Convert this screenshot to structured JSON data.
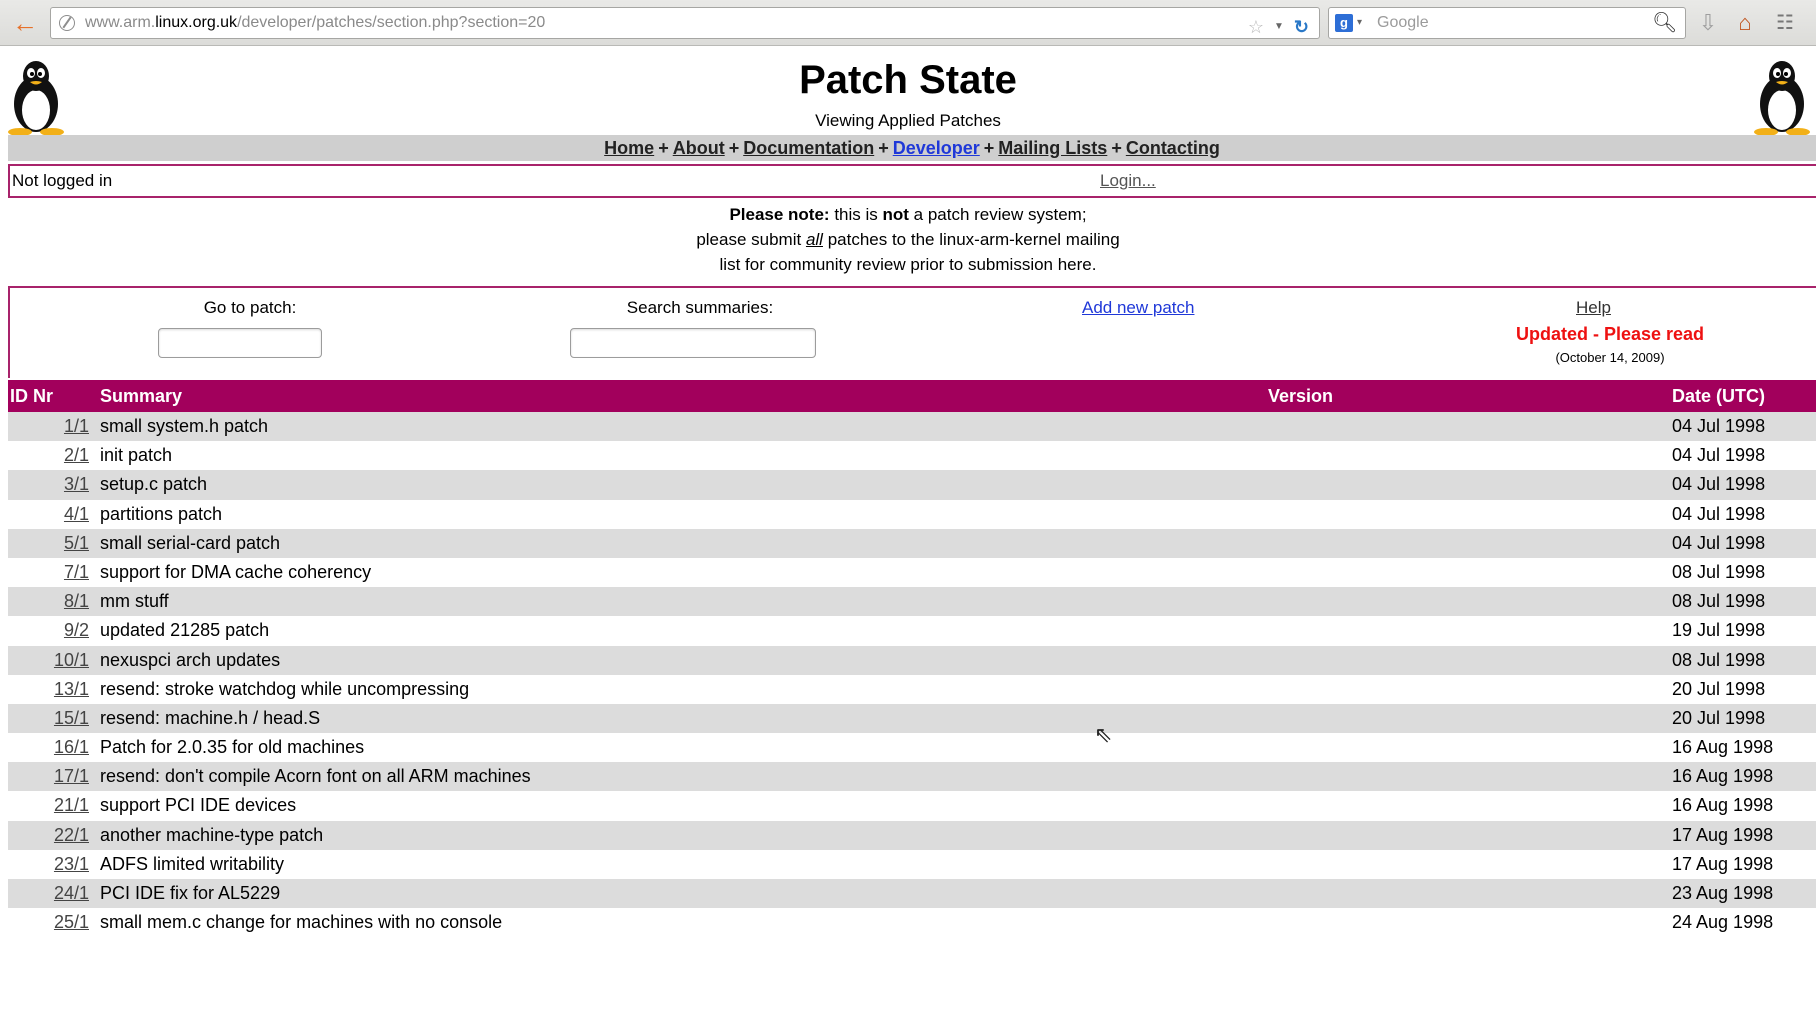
{
  "browser": {
    "url_prefix": "www.arm.",
    "url_host": "linux.org.uk",
    "url_path": "/developer/patches/section.php?section=20",
    "search_placeholder": "Google"
  },
  "page": {
    "title": "Patch State",
    "subtitle": "Viewing Applied Patches"
  },
  "nav": {
    "items": [
      "Home",
      "About",
      "Documentation",
      "Developer",
      "Mailing Lists",
      "Contacting"
    ],
    "separator": "+"
  },
  "login": {
    "status": "Not logged in",
    "link": "Login..."
  },
  "note": {
    "bold_intro": "Please note:",
    "line1_a": " this is ",
    "line1_bold": "not",
    "line1_b": " a patch review system;",
    "line2_a": "please submit ",
    "line2_em": "all",
    "line2_b": " patches to the linux-arm-kernel mailing",
    "line3": "list for community review prior to submission here."
  },
  "controls": {
    "goto_label": "Go to patch:",
    "search_label": "Search summaries:",
    "add_link": "Add new patch",
    "help_link": "Help",
    "updated": "Updated - Please read",
    "updated_date": "(October 14, 2009)"
  },
  "table": {
    "headers": {
      "id": "ID Nr",
      "summary": "Summary",
      "version": "Version",
      "date": "Date (UTC)"
    },
    "rows": [
      {
        "id": "1/1",
        "summary": "small system.h patch",
        "date": "04 Jul 1998"
      },
      {
        "id": "2/1",
        "summary": "init patch",
        "date": "04 Jul 1998"
      },
      {
        "id": "3/1",
        "summary": "setup.c patch",
        "date": "04 Jul 1998"
      },
      {
        "id": "4/1",
        "summary": "partitions patch",
        "date": "04 Jul 1998"
      },
      {
        "id": "5/1",
        "summary": "small serial-card patch",
        "date": "04 Jul 1998"
      },
      {
        "id": "7/1",
        "summary": "support for DMA cache coherency",
        "date": "08 Jul 1998"
      },
      {
        "id": "8/1",
        "summary": "mm stuff",
        "date": "08 Jul 1998"
      },
      {
        "id": "9/2",
        "summary": "updated 21285 patch",
        "date": "19 Jul 1998"
      },
      {
        "id": "10/1",
        "summary": "nexuspci arch updates",
        "date": "08 Jul 1998"
      },
      {
        "id": "13/1",
        "summary": "resend: stroke watchdog while uncompressing",
        "date": "20 Jul 1998"
      },
      {
        "id": "15/1",
        "summary": "resend: machine.h / head.S",
        "date": "20 Jul 1998"
      },
      {
        "id": "16/1",
        "summary": "Patch for 2.0.35 for old machines",
        "date": "16 Aug 1998"
      },
      {
        "id": "17/1",
        "summary": "resend: don't compile Acorn font on all ARM machines",
        "date": "16 Aug 1998"
      },
      {
        "id": "21/1",
        "summary": "support PCI IDE devices",
        "date": "16 Aug 1998"
      },
      {
        "id": "22/1",
        "summary": "another machine-type patch",
        "date": "17 Aug 1998"
      },
      {
        "id": "23/1",
        "summary": "ADFS limited writability",
        "date": "17 Aug 1998"
      },
      {
        "id": "24/1",
        "summary": "PCI IDE fix for AL5229",
        "date": "23 Aug 1998"
      },
      {
        "id": "25/1",
        "summary": "small mem.c change for machines with no console",
        "date": "24 Aug 1998"
      }
    ]
  }
}
